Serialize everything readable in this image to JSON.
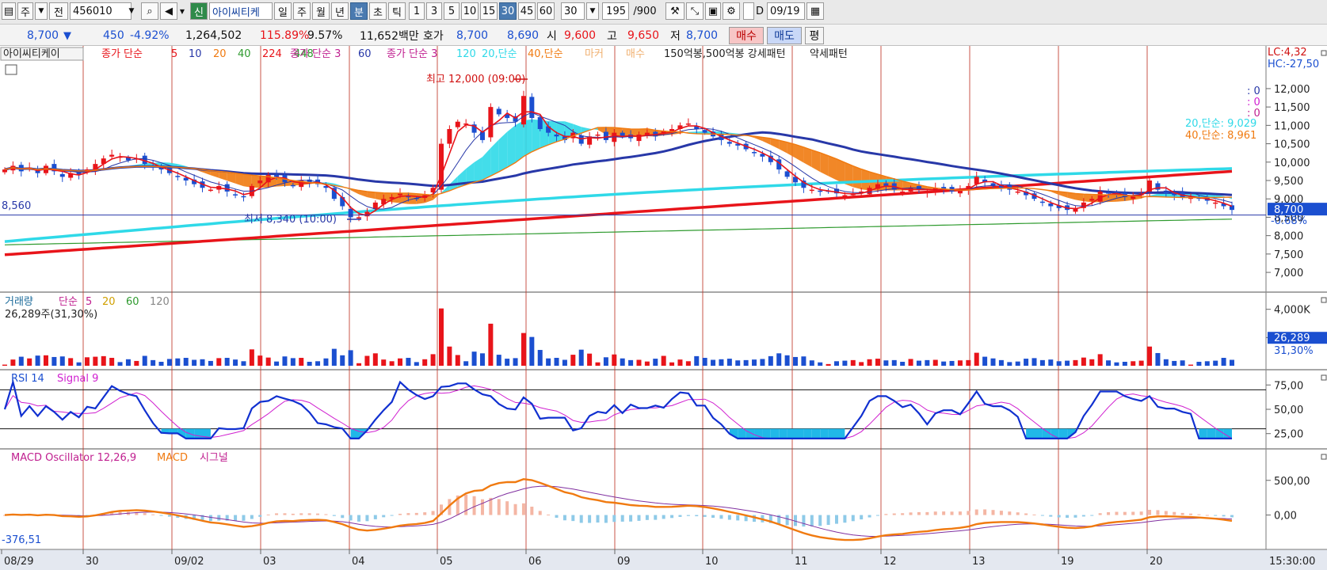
{
  "toolbar": {
    "market_tab": "주",
    "prev_tab": "전",
    "code": "456010",
    "news_badge": "신",
    "stock_name": "아이씨티케",
    "period_buttons": [
      "일",
      "주",
      "월",
      "년",
      "분",
      "초",
      "틱"
    ],
    "selected_period": "분",
    "interval_buttons": [
      "1",
      "3",
      "5",
      "10",
      "15",
      "30",
      "45",
      "60"
    ],
    "selected_interval": "30",
    "interval_value": "30",
    "count": "195",
    "count_total": "/900",
    "checkbox_label": "D",
    "date": "09/19"
  },
  "infobar": {
    "price": "8,700",
    "arrow": "▼",
    "change": "450",
    "change_pct": "-4.92%",
    "volume": "1,264,502",
    "vol_ratio": "115.89%",
    "turnover": "9.57%",
    "amount": "11,652백만",
    "quote_label": "호가",
    "ask": "8,700",
    "bid": "8,690",
    "open_label": "시",
    "open": "9,600",
    "high_label": "고",
    "high": "9,650",
    "low_label": "저",
    "low": "8,700",
    "buy_btn": "매수",
    "sell_btn": "매도",
    "eval_btn": "평"
  },
  "colors": {
    "up": "#e8141a",
    "down": "#1b4fd0",
    "ma5": "#e8141a",
    "ma10": "#2838a8",
    "ma20": "#2fd9e8",
    "ma40": "#f07a10",
    "ma224": "#e8141a",
    "ma448": "#2e9a2e",
    "vline": "#c0392b",
    "rsi": "#1030d0",
    "signal": "#d020d0",
    "macd": "#f07a10",
    "macd_signal": "#8030a0"
  },
  "chart_data": [
    {
      "type": "candlestick",
      "legend": {
        "stock": "아이씨티케이",
        "ma_title": "종가 단순",
        "ma_periods": [
          "5",
          "10",
          "20",
          "40",
          "224",
          "448"
        ],
        "ma2_title": "종가 단순 3",
        "ma2_period": "60",
        "ma3_title": "종가 단순 3",
        "ma3_period": "120",
        "ma20_label": "20,단순",
        "ma40_label": "40,단순",
        "mark_label": "마커",
        "mark_label2": "매수",
        "pattern_label": "150억봉,500억봉 강세패턴",
        "pattern_label2": "약세패턴"
      },
      "y_ticks": [
        "12,000",
        "11,500",
        "11,000",
        "10,500",
        "10,000",
        "9,500",
        "9,000",
        "8,500",
        "8,000",
        "7,500",
        "7,000"
      ],
      "ylim": [
        6700,
        12300
      ],
      "x_ticks": [
        "08/29",
        "30",
        "09/02",
        "03",
        "04",
        "05",
        "06",
        "09",
        "10",
        "11",
        "12",
        "13",
        "19",
        "20"
      ],
      "high_annotation": "최고 12,000 (09:00)",
      "low_annotation": "최저 8,340 (10:00)",
      "left_price_label": "8,560",
      "last_price_label": "8,700",
      "last_pct_label": "-0.68%",
      "lc_label": "LC:4,32",
      "hc_label": "HC:-27,50",
      "ma20_value_label": "20,단순: 9,029",
      "ma40_value_label": "40,단순: 8,961",
      "mini_labels": [
        ": 0",
        ": 0",
        ": 0"
      ],
      "time_label": "15:30:00",
      "close_path": [
        9800,
        9900,
        9750,
        9850,
        9700,
        9900,
        9750,
        9600,
        9700,
        9650,
        9800,
        9950,
        10100,
        10200,
        10150,
        10050,
        10100,
        9950,
        9850,
        9800,
        9700,
        9600,
        9500,
        9400,
        9300,
        9250,
        9350,
        9200,
        9100,
        9050,
        9350,
        9500,
        9650,
        9600,
        9450,
        9350,
        9500,
        9450,
        9400,
        9300,
        9000,
        8800,
        8500,
        8500,
        8650,
        8900,
        9000,
        9050,
        9150,
        9050,
        9000,
        9100,
        9300,
        10500,
        10900,
        11100,
        11050,
        10800,
        10600,
        11500,
        11300,
        11200,
        11100,
        11800,
        11200,
        10900,
        10800,
        10700,
        10600,
        10800,
        10500,
        10700,
        10750,
        10600,
        10800,
        10700,
        10650,
        10750,
        10800,
        10700,
        10850,
        10900,
        11000,
        11050,
        10900,
        10800,
        10700,
        10600,
        10500,
        10450,
        10350,
        10250,
        10150,
        10000,
        9800,
        9600,
        9450,
        9300,
        9250,
        9200,
        9200,
        9150,
        9100,
        9150,
        9200,
        9300,
        9400,
        9350,
        9250,
        9200,
        9300,
        9250,
        9200,
        9300,
        9250,
        9200,
        9250,
        9350,
        9600,
        9450,
        9350,
        9300,
        9250,
        9200,
        9100,
        9000,
        8900,
        8800,
        8750,
        8700,
        8750,
        8900,
        9000,
        9200,
        9150,
        9100,
        9050,
        9100,
        9150,
        9500,
        9250,
        9150,
        9100,
        9050,
        9050,
        9000,
        8950,
        8900,
        8800,
        8700
      ]
    },
    {
      "type": "bar",
      "title": "거래량",
      "ma_title": "단순",
      "ma_periods": [
        "5",
        "20",
        "60",
        "120"
      ],
      "current_label": "26,289주(31,30%)",
      "y_ticks": [
        "4,000K",
        "2,000K"
      ],
      "last_value_label": "26,289",
      "last_pct_label": "31,30%"
    },
    {
      "type": "line",
      "title": "RSI 14",
      "signal_title": "Signal 9",
      "y_ticks": [
        "75,00",
        "50,00",
        "25,00"
      ],
      "ylim": [
        15,
        85
      ]
    },
    {
      "type": "line",
      "title": "MACD Oscillator 12,26,9",
      "macd_title": "MACD",
      "signal_title": "시그널",
      "y_ticks": [
        "500,00",
        "0,00"
      ],
      "current_label": "-376,51"
    }
  ]
}
